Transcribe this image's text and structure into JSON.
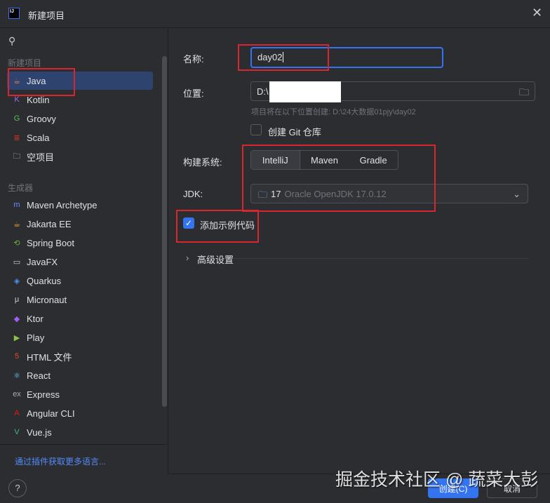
{
  "window": {
    "title": "新建项目",
    "logo": "IJ"
  },
  "sidebar": {
    "section_new": "新建项目",
    "new_items": [
      {
        "label": "Java",
        "icon": "java-cup-icon"
      },
      {
        "label": "Kotlin",
        "icon": "kotlin-icon"
      },
      {
        "label": "Groovy",
        "icon": "groovy-icon"
      },
      {
        "label": "Scala",
        "icon": "scala-icon"
      },
      {
        "label": "空项目",
        "icon": "folder-icon"
      }
    ],
    "section_gen": "生成器",
    "generators": [
      {
        "label": "Maven Archetype",
        "glyph": "m",
        "color": "#6c8cff"
      },
      {
        "label": "Jakarta EE",
        "glyph": "☕",
        "color": "#f0a030"
      },
      {
        "label": "Spring Boot",
        "glyph": "⟲",
        "color": "#6db33f"
      },
      {
        "label": "JavaFX",
        "glyph": "▭",
        "color": "#ccc"
      },
      {
        "label": "Quarkus",
        "glyph": "◈",
        "color": "#4695eb"
      },
      {
        "label": "Micronaut",
        "glyph": "μ",
        "color": "#ccc"
      },
      {
        "label": "Ktor",
        "glyph": "◆",
        "color": "#a35cf5"
      },
      {
        "label": "Play",
        "glyph": "▶",
        "color": "#8bc34a"
      },
      {
        "label": "HTML 文件",
        "glyph": "5",
        "color": "#e44d26"
      },
      {
        "label": "React",
        "glyph": "⚛",
        "color": "#61dafb"
      },
      {
        "label": "Express",
        "glyph": "ex",
        "color": "#aaa"
      },
      {
        "label": "Angular CLI",
        "glyph": "A",
        "color": "#dd1b16"
      },
      {
        "label": "Vue.js",
        "glyph": "V",
        "color": "#41b883"
      }
    ],
    "more_link": "通过插件获取更多语言..."
  },
  "form": {
    "name_label": "名称:",
    "name_value": "day02",
    "location_label": "位置:",
    "location_value": "D:\\",
    "location_hint": "项目将在以下位置创建: D:\\24大数据01pjy\\day02",
    "git_label": "创建 Git 仓库",
    "git_checked": false,
    "build_label": "构建系统:",
    "build_options": [
      "IntelliJ",
      "Maven",
      "Gradle"
    ],
    "build_selected": "IntelliJ",
    "jdk_label": "JDK:",
    "jdk_version": "17",
    "jdk_name": "Oracle OpenJDK 17.0.12",
    "sample_label": "添加示例代码",
    "sample_checked": true,
    "advanced_label": "高级设置"
  },
  "buttons": {
    "create": "创建(C)",
    "cancel": "取消",
    "help": "?"
  },
  "watermark": "掘金技术社区 @ 蔬菜大彭",
  "colors": {
    "accent": "#3574f0",
    "annotation": "#d7262e"
  }
}
